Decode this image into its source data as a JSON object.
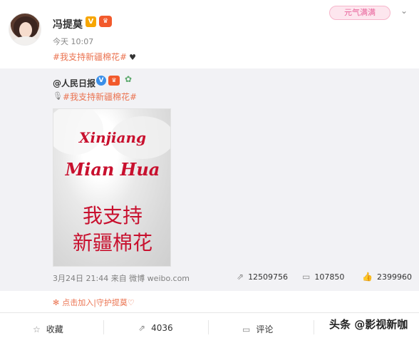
{
  "author": {
    "name": "冯提莫",
    "vip_badge": "V",
    "crown_badge": "♛",
    "time": "今天 10:07",
    "topic": "#我支持新疆棉花#",
    "heart": "♥",
    "sticker": "元气满满"
  },
  "repost": {
    "orig_user": "@人民日报",
    "v_badge": "V",
    "orig_topic": "#我支持新疆棉花#",
    "poster": {
      "en_line1": "Xinjiang",
      "en_line2": "Mian Hua",
      "zh_line1": "我支持",
      "zh_line2": "新疆棉花"
    },
    "meta": "3月24日 21:44 来自 微博 weibo.com",
    "reposts": "12509756",
    "comments": "107850",
    "likes": "2399960"
  },
  "guard_link": "点击加入|守护提莫♡",
  "actions": {
    "favorite": "收藏",
    "repost": "4036",
    "comment": "评论"
  },
  "watermark": "头条 @影视新咖",
  "colors": {
    "link": "#eb7350",
    "poster_red": "#c8102e",
    "repost_bg": "#f2f2f5"
  }
}
